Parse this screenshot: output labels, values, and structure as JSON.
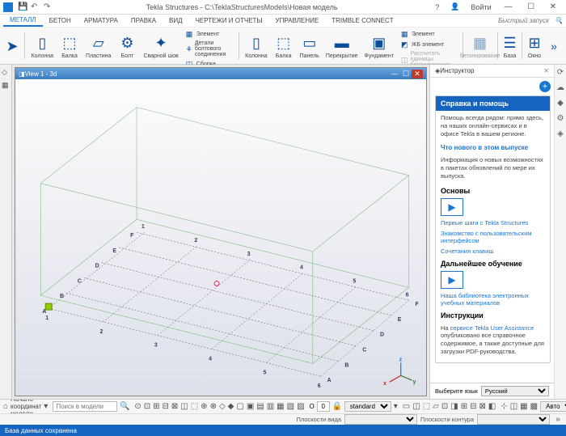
{
  "titlebar": {
    "title": "Tekla Structures - C:\\TeklaStructuresModels\\Новая модель",
    "login": "Войти",
    "help": "?"
  },
  "menubar": {
    "tabs": [
      "МЕТАЛЛ",
      "БЕТОН",
      "АРМАТУРА",
      "ПРАВКА",
      "ВИД",
      "ЧЕРТЕЖИ И ОТЧЕТЫ",
      "УПРАВЛЕНИЕ",
      "TRIMBLE CONNECT"
    ],
    "search_placeholder": "Быстрый запуск"
  },
  "ribbon": {
    "column": "Колонна",
    "beam": "Балка",
    "plate": "Пластина",
    "bolt": "Болт",
    "weld": "Сварной шов",
    "element": "Элемент",
    "bolt_details": "Детали болтового соединения",
    "assembly": "Сборка",
    "column2": "Колонна",
    "beam2": "Балка",
    "panel": "Панель",
    "slab": "Перекрытие",
    "foundation": "Фундамент",
    "element2": "Элемент",
    "rc_element": "ЖБ элемент",
    "cast_unit": "Рассчитать единицы бетонирования",
    "concreting": "бетонирование",
    "base": "База",
    "window": "Окно"
  },
  "view": {
    "title": "View 1 - 3d"
  },
  "grid": {
    "letters": [
      "A",
      "B",
      "C",
      "D",
      "E",
      "F"
    ],
    "numbers": [
      "1",
      "2",
      "3",
      "4",
      "5",
      "6"
    ]
  },
  "instructor": {
    "header": "Инструктор",
    "card_title": "Справка и помощь",
    "help_text": "Помощь всегда рядом: прямо здесь, на наших онлайн-сервисах и в офисе Tekla в вашем регионе.",
    "whats_new": "Что нового в этом выпуске",
    "whats_new_text": "Информация о новых возможностях в пакетах обновлений по мере их выпуска.",
    "basics": "Основы",
    "first_steps": "Первые шаги с Tekla Structures",
    "ui_intro": "Знакомство с пользовательским интерфейсом",
    "shortcuts": "Сочетания клавиш",
    "further": "Дальнейшее обучение",
    "library": "Наша библиотека электронных учебных материалов",
    "instructions": "Инструкции",
    "instructions_text_1": "На ",
    "instructions_link": "сервисе Tekla User Assistance",
    "instructions_text_2": " опубликовано все справочное содержимое, а также доступные для загрузки PDF-руководства.",
    "lang_label": "Выберите язык",
    "lang_value": "Русский"
  },
  "bottombar": {
    "origin": "Начало координат модели",
    "search_placeholder": "Поиск в модели",
    "o_value": "0",
    "standard": "standard",
    "auto": "Авто"
  },
  "bottombar2": {
    "view_plane": "Плоскости вида",
    "contour_plane": "Плоскости контура"
  },
  "status": "База данных сохранена"
}
